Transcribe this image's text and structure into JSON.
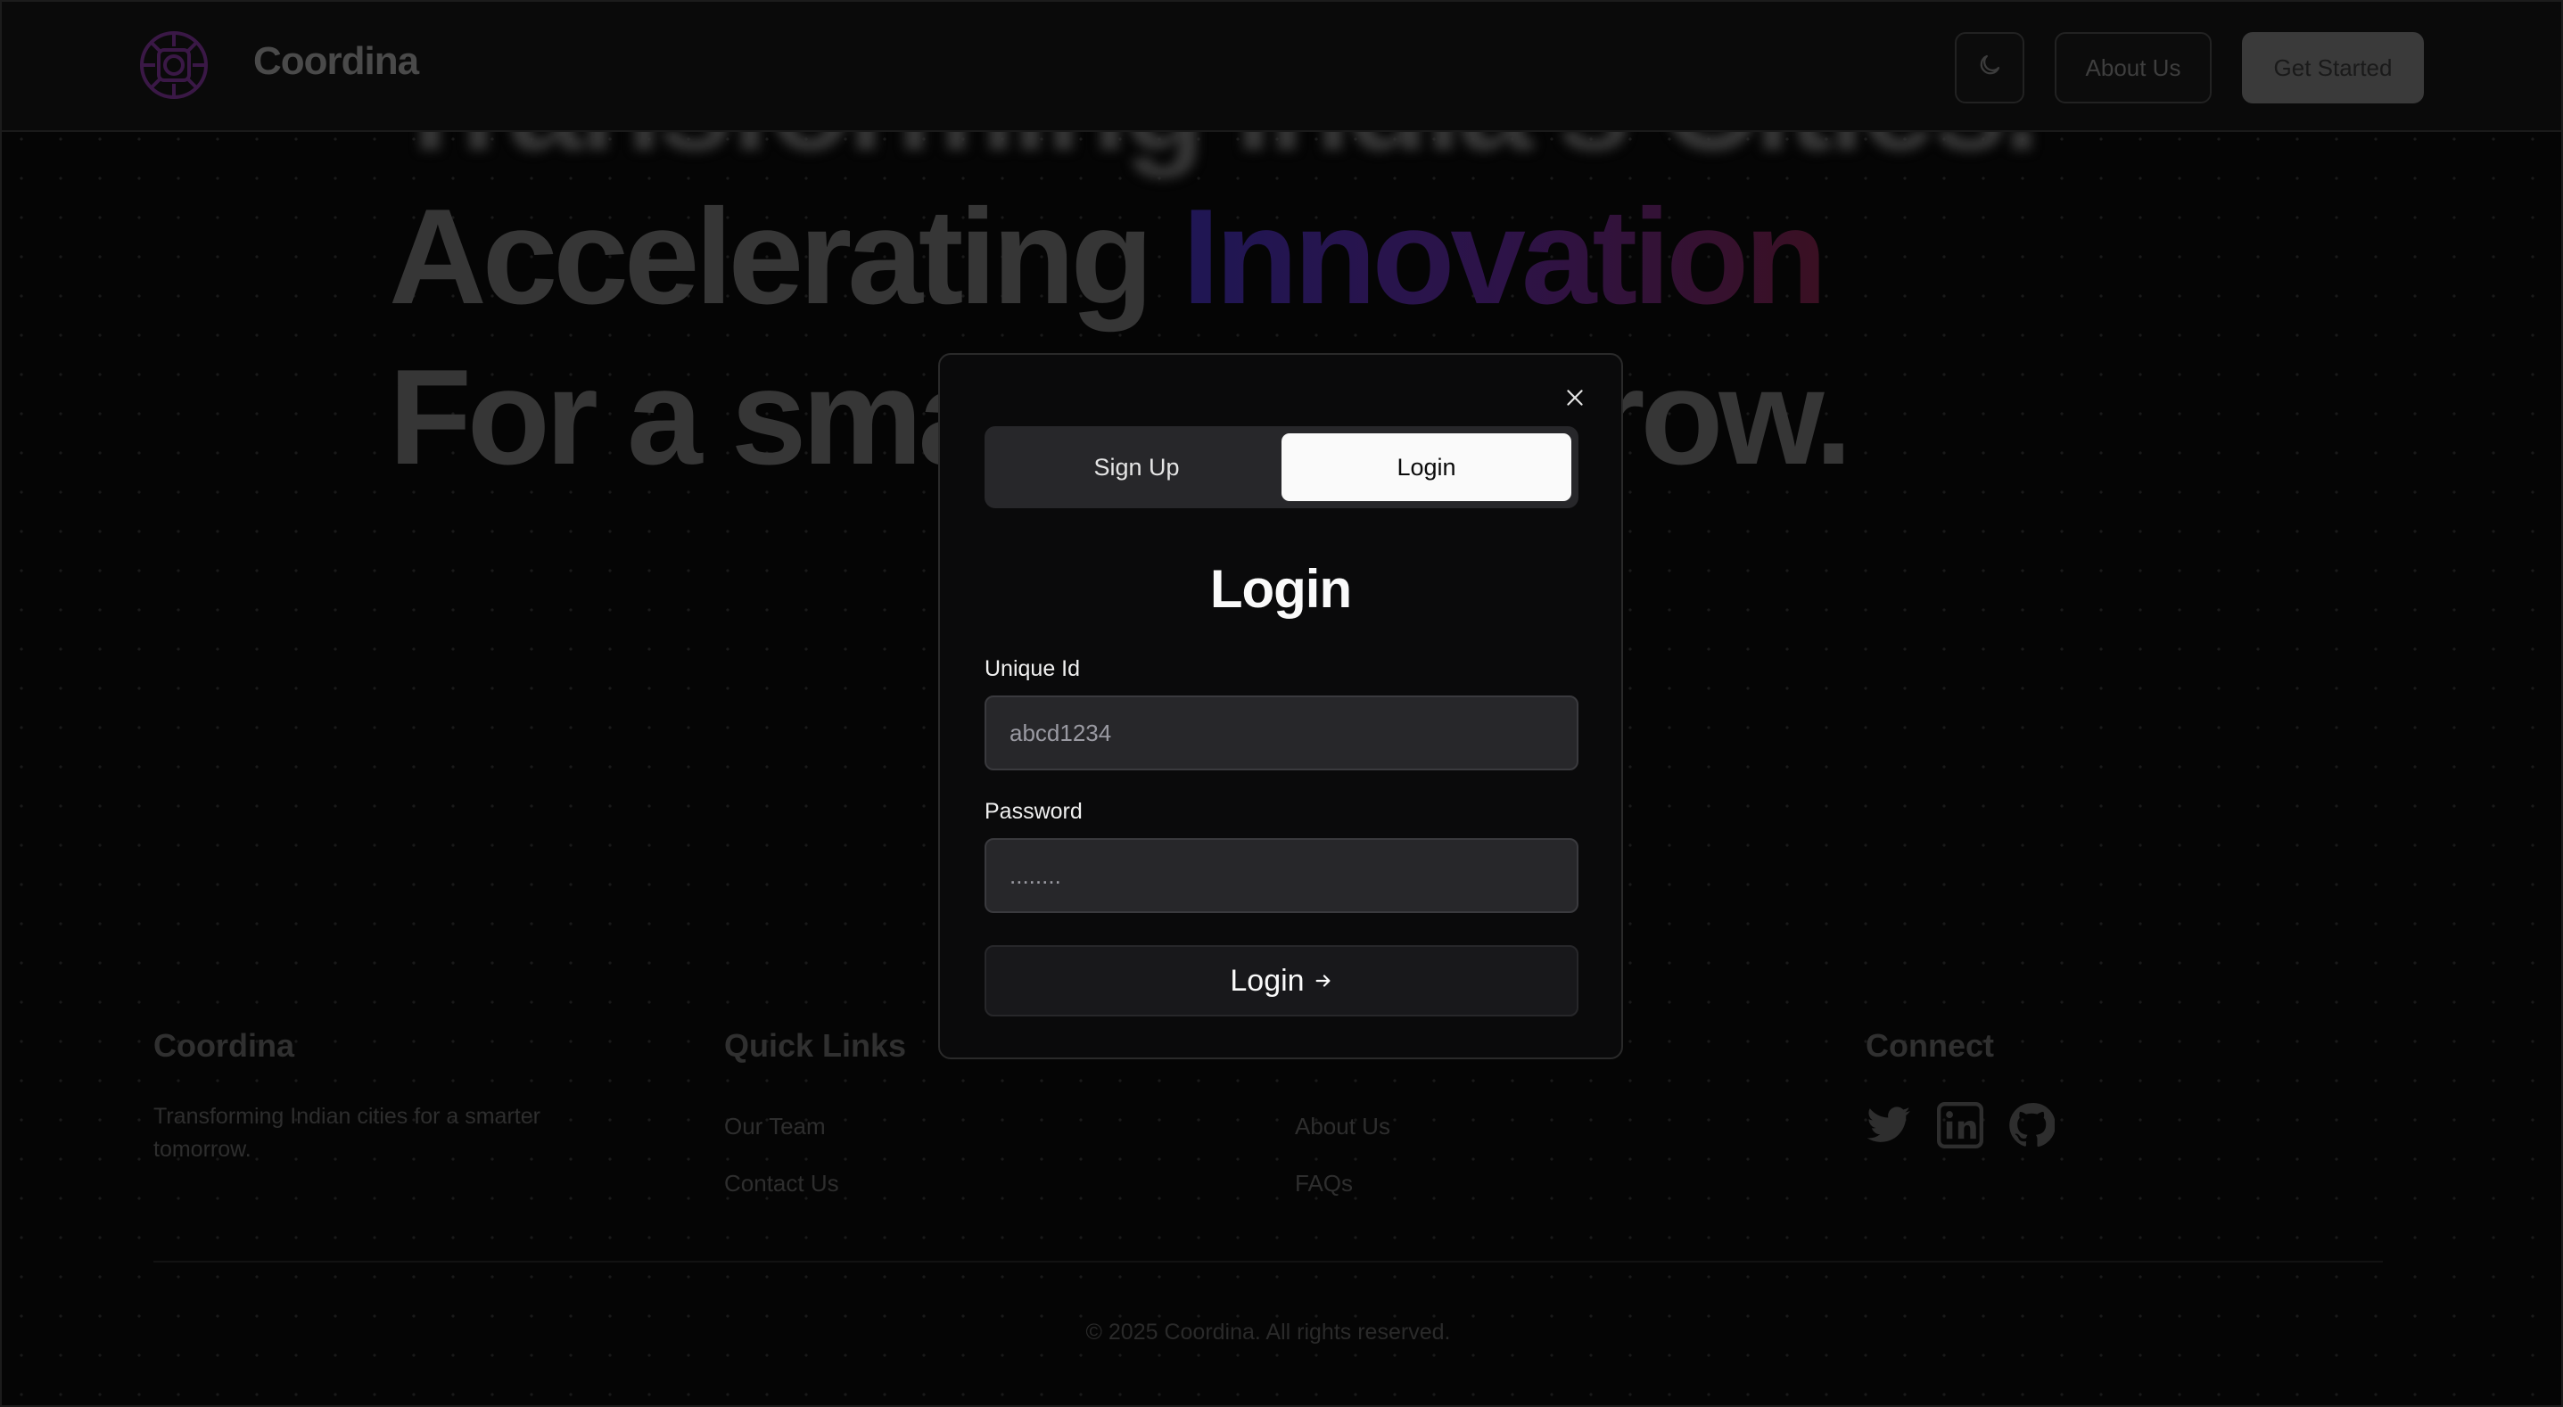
{
  "nav": {
    "brand": "Coordina",
    "theme_icon": "moon-icon",
    "about_label": "About Us",
    "start_label": "Get Started"
  },
  "hero": {
    "line0": "Transforming India's Cities.",
    "line1_plain": "Accelerating ",
    "line1_accent": "Innovation",
    "line2": "For a smarter tomorrow."
  },
  "modal": {
    "close_icon": "close-icon",
    "tabs": [
      {
        "label": "Sign Up",
        "active": false
      },
      {
        "label": "Login",
        "active": true
      }
    ],
    "title": "Login",
    "unique_id": {
      "label": "Unique Id",
      "placeholder": "abcd1234"
    },
    "password": {
      "label": "Password",
      "placeholder": "........"
    },
    "submit_label": "Login",
    "submit_icon": "arrow-right-icon"
  },
  "footer": {
    "brand_heading": "Coordina",
    "tagline": "Transforming Indian cities for a smarter tomorrow.",
    "quick_links_heading": "Quick Links",
    "quick_links_col1": [
      "Our Team",
      "Contact Us"
    ],
    "quick_links_col2": [
      "About Us",
      "FAQs"
    ],
    "connect_heading": "Connect",
    "social_icons": [
      "twitter-icon",
      "linkedin-icon",
      "github-icon"
    ],
    "copyright": "© 2025 Coordina. All rights reserved."
  },
  "colors": {
    "accent_gradient_start": "#1f1654",
    "accent_gradient_end": "#3a1022",
    "logo": "#3a1846"
  }
}
